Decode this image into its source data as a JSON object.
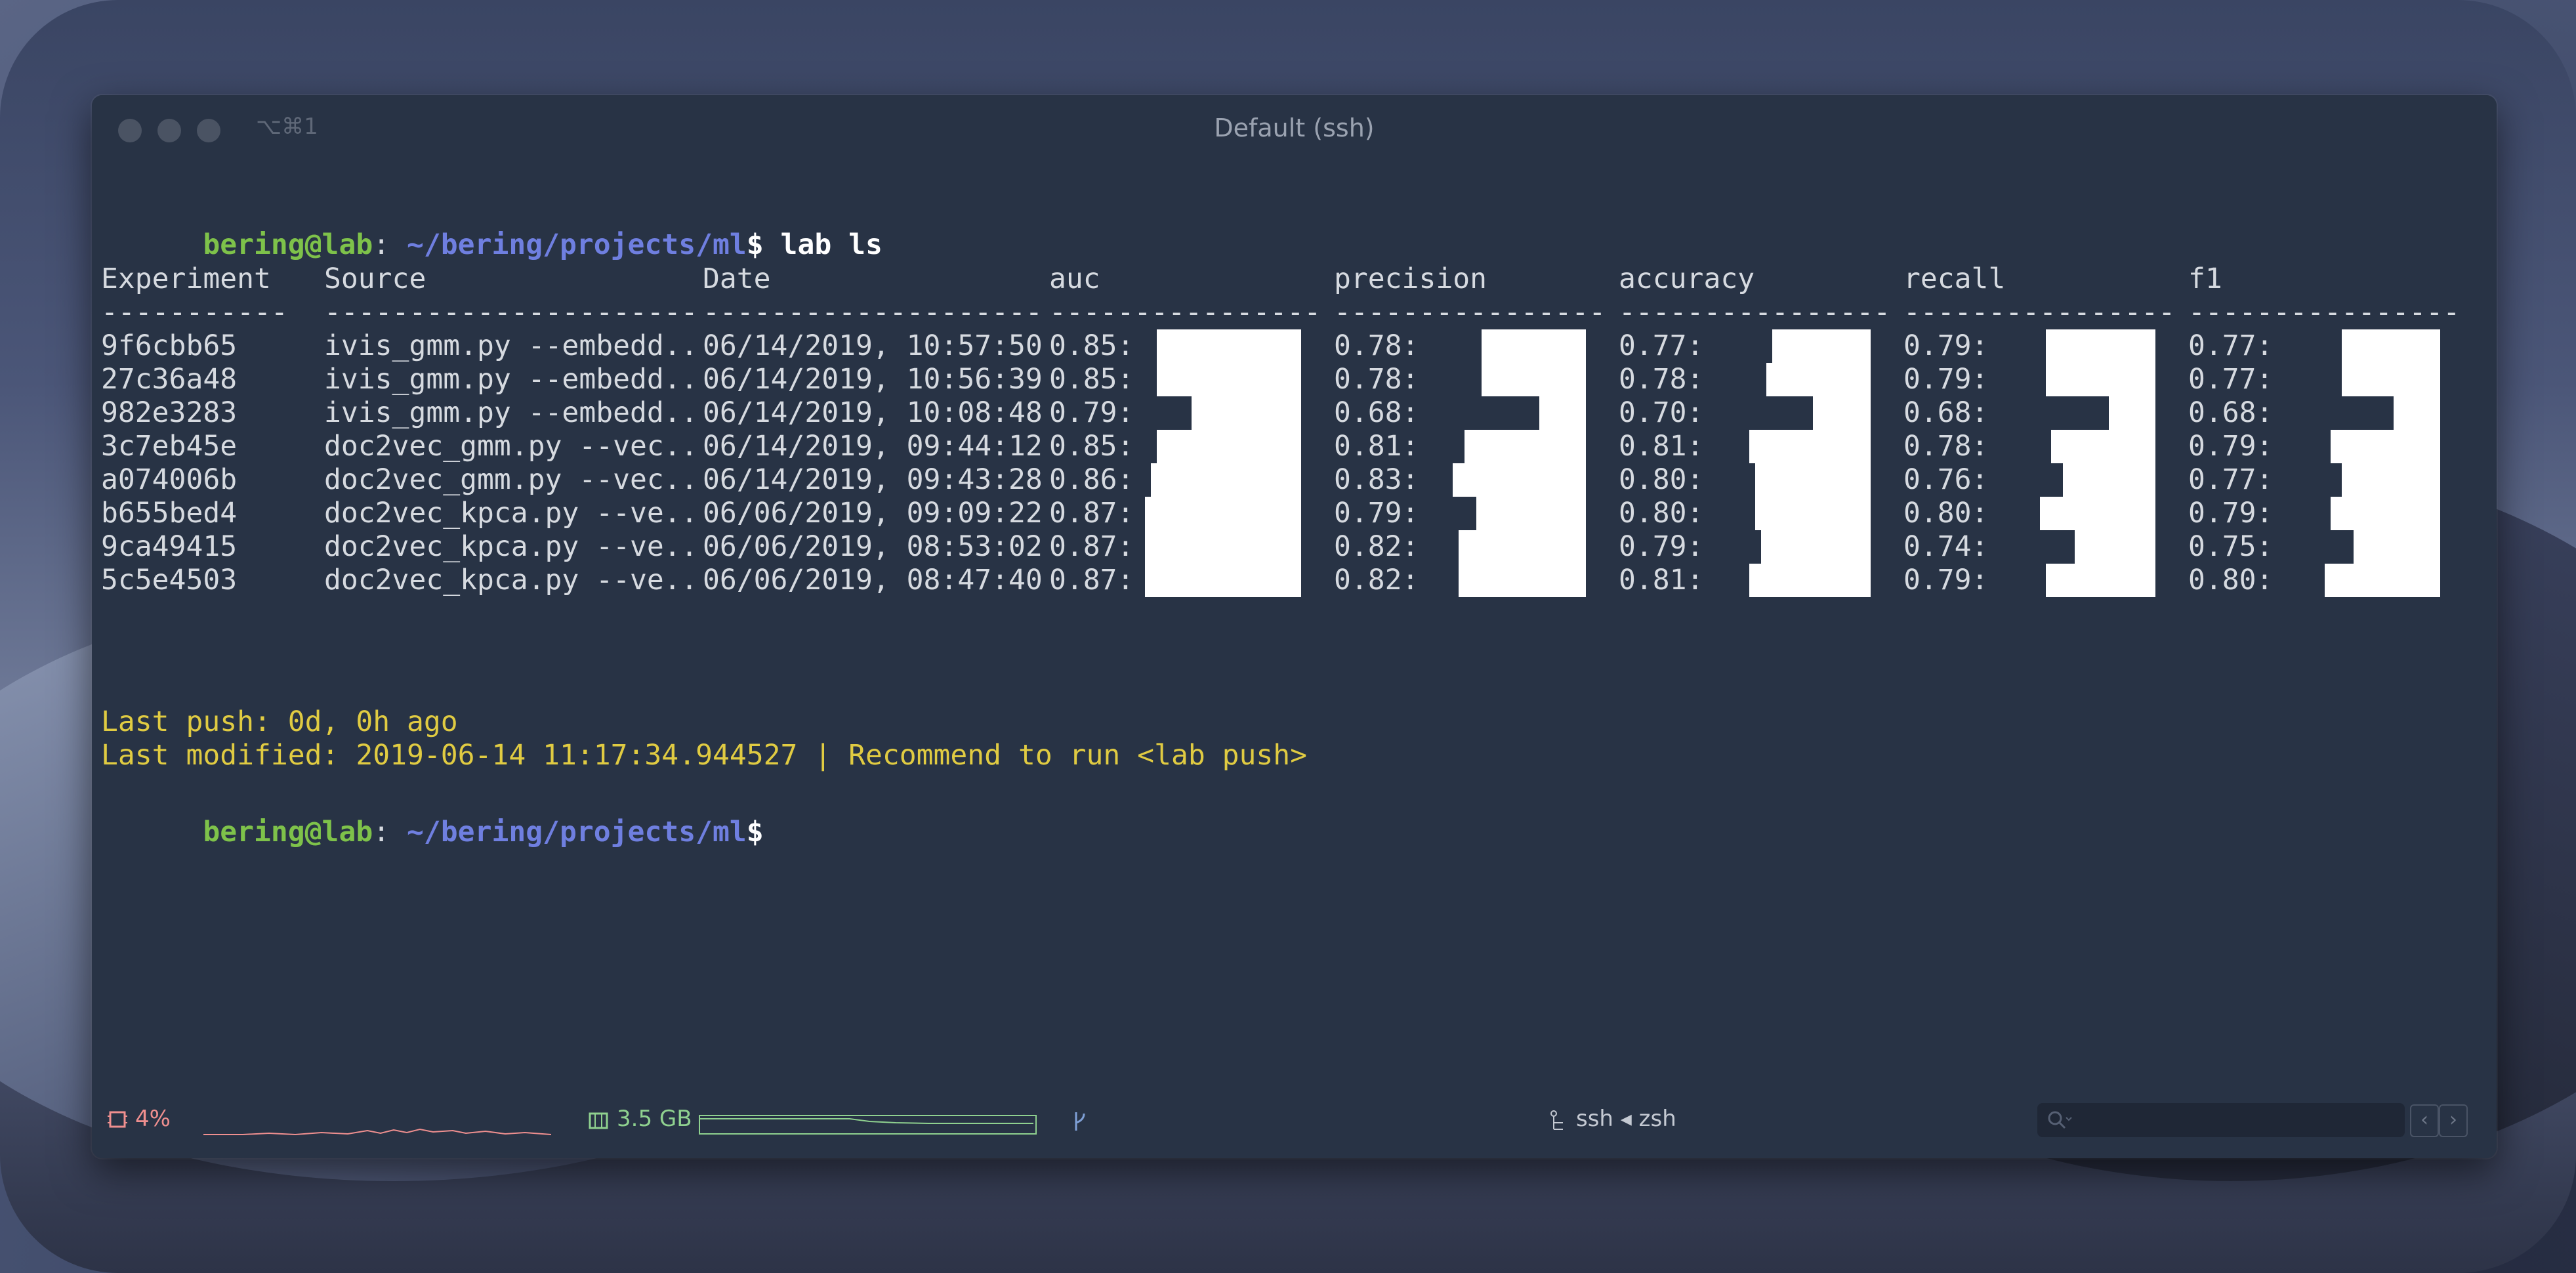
{
  "window": {
    "shortcut": "⌥⌘1",
    "title": "Default (ssh)"
  },
  "terminal": {
    "prompt": {
      "user": "bering@lab",
      "sep": ": ",
      "path": "~/bering/projects/ml",
      "dollar": "$"
    },
    "command": " lab ls",
    "headers": [
      "Experiment",
      "Source",
      "Date",
      "auc",
      "precision",
      "accuracy",
      "recall",
      "f1"
    ],
    "dividers": [
      "-----------",
      "----------------------",
      "--------------------",
      "----------------",
      "----------------",
      "----------------",
      "----------------",
      "----------------"
    ],
    "rows": [
      {
        "experiment": "9f6cbb65",
        "source": "ivis_gmm.py --embedd..",
        "date": "06/14/2019, 10:57:50",
        "auc": "0.85:",
        "precision": "0.78:",
        "accuracy": "0.77:",
        "recall": "0.79:",
        "f1": "0.77:"
      },
      {
        "experiment": "27c36a48",
        "source": "ivis_gmm.py --embedd..",
        "date": "06/14/2019, 10:56:39",
        "auc": "0.85:",
        "precision": "0.78:",
        "accuracy": "0.78:",
        "recall": "0.79:",
        "f1": "0.77:"
      },
      {
        "experiment": "982e3283",
        "source": "ivis_gmm.py --embedd..",
        "date": "06/14/2019, 10:08:48",
        "auc": "0.79:",
        "precision": "0.68:",
        "accuracy": "0.70:",
        "recall": "0.68:",
        "f1": "0.68:"
      },
      {
        "experiment": "3c7eb45e",
        "source": "doc2vec_gmm.py --vec..",
        "date": "06/14/2019, 09:44:12",
        "auc": "0.85:",
        "precision": "0.81:",
        "accuracy": "0.81:",
        "recall": "0.78:",
        "f1": "0.79:"
      },
      {
        "experiment": "a074006b",
        "source": "doc2vec_gmm.py --vec..",
        "date": "06/14/2019, 09:43:28",
        "auc": "0.86:",
        "precision": "0.83:",
        "accuracy": "0.80:",
        "recall": "0.76:",
        "f1": "0.77:"
      },
      {
        "experiment": "b655bed4",
        "source": "doc2vec_kpca.py --ve..",
        "date": "06/06/2019, 09:09:22",
        "auc": "0.87:",
        "precision": "0.79:",
        "accuracy": "0.80:",
        "recall": "0.80:",
        "f1": "0.79:"
      },
      {
        "experiment": "9ca49415",
        "source": "doc2vec_kpca.py --ve..",
        "date": "06/06/2019, 08:53:02",
        "auc": "0.87:",
        "precision": "0.82:",
        "accuracy": "0.79:",
        "recall": "0.74:",
        "f1": "0.75:"
      },
      {
        "experiment": "5c5e4503",
        "source": "doc2vec_kpca.py --ve..",
        "date": "06/06/2019, 08:47:40",
        "auc": "0.87:",
        "precision": "0.82:",
        "accuracy": "0.81:",
        "recall": "0.79:",
        "f1": "0.80:"
      }
    ],
    "last_push": "Last push: 0d, 0h ago",
    "last_modified": "Last modified: 2019-06-14 11:17:34.944527 | Recommend to run <lab push>"
  },
  "status_bar": {
    "cpu": "4%",
    "memory": "3.5 GB",
    "session": "ssh ◂ zsh"
  },
  "colors": {
    "background": "#283345",
    "prompt_user": "#7ec24a",
    "prompt_path": "#6f7fe0",
    "warning": "#e0cb42"
  }
}
